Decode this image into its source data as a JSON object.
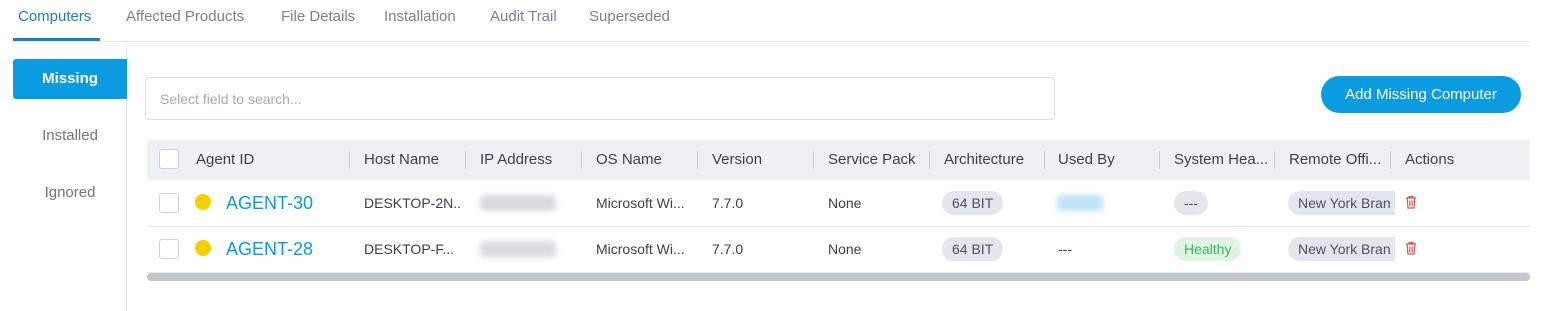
{
  "tabs": [
    {
      "label": "Computers"
    },
    {
      "label": "Affected Products"
    },
    {
      "label": "File Details"
    },
    {
      "label": "Installation"
    },
    {
      "label": "Audit Trail"
    },
    {
      "label": "Superseded"
    }
  ],
  "active_tab": "Computers",
  "subnav": [
    {
      "label": "Missing"
    },
    {
      "label": "Installed"
    },
    {
      "label": "Ignored"
    }
  ],
  "active_subnav": "Missing",
  "search": {
    "placeholder": "Select field to search...",
    "value": ""
  },
  "add_button": {
    "label": "Add Missing Computer"
  },
  "table": {
    "columns": [
      "Agent ID",
      "Host Name",
      "IP Address",
      "OS Name",
      "Version",
      "Service Pack",
      "Architecture",
      "Used By",
      "System Hea...",
      "Remote Offi...",
      "Actions"
    ],
    "rows": [
      {
        "agent_id": "AGENT-30",
        "host_name": "DESKTOP-2N...",
        "os_name": "Microsoft Wi...",
        "version": "7.7.0",
        "service_pack": "None",
        "architecture": "64 BIT",
        "used_by": "",
        "system_health": "---",
        "remote_office": "New York Bran"
      },
      {
        "agent_id": "AGENT-28",
        "host_name": "DESKTOP-F...",
        "os_name": "Microsoft Wi...",
        "version": "7.7.0",
        "service_pack": "None",
        "architecture": "64 BIT",
        "used_by": "---",
        "system_health": "Healthy",
        "remote_office": "New York Bran"
      }
    ]
  },
  "colors": {
    "accent": "#0b9be0",
    "tab_active": "#1f7ec2",
    "status_dot": "#f5d000",
    "healthy": "#3cb561",
    "delete": "#e0524f"
  },
  "icons": {
    "delete": "trash-icon"
  }
}
